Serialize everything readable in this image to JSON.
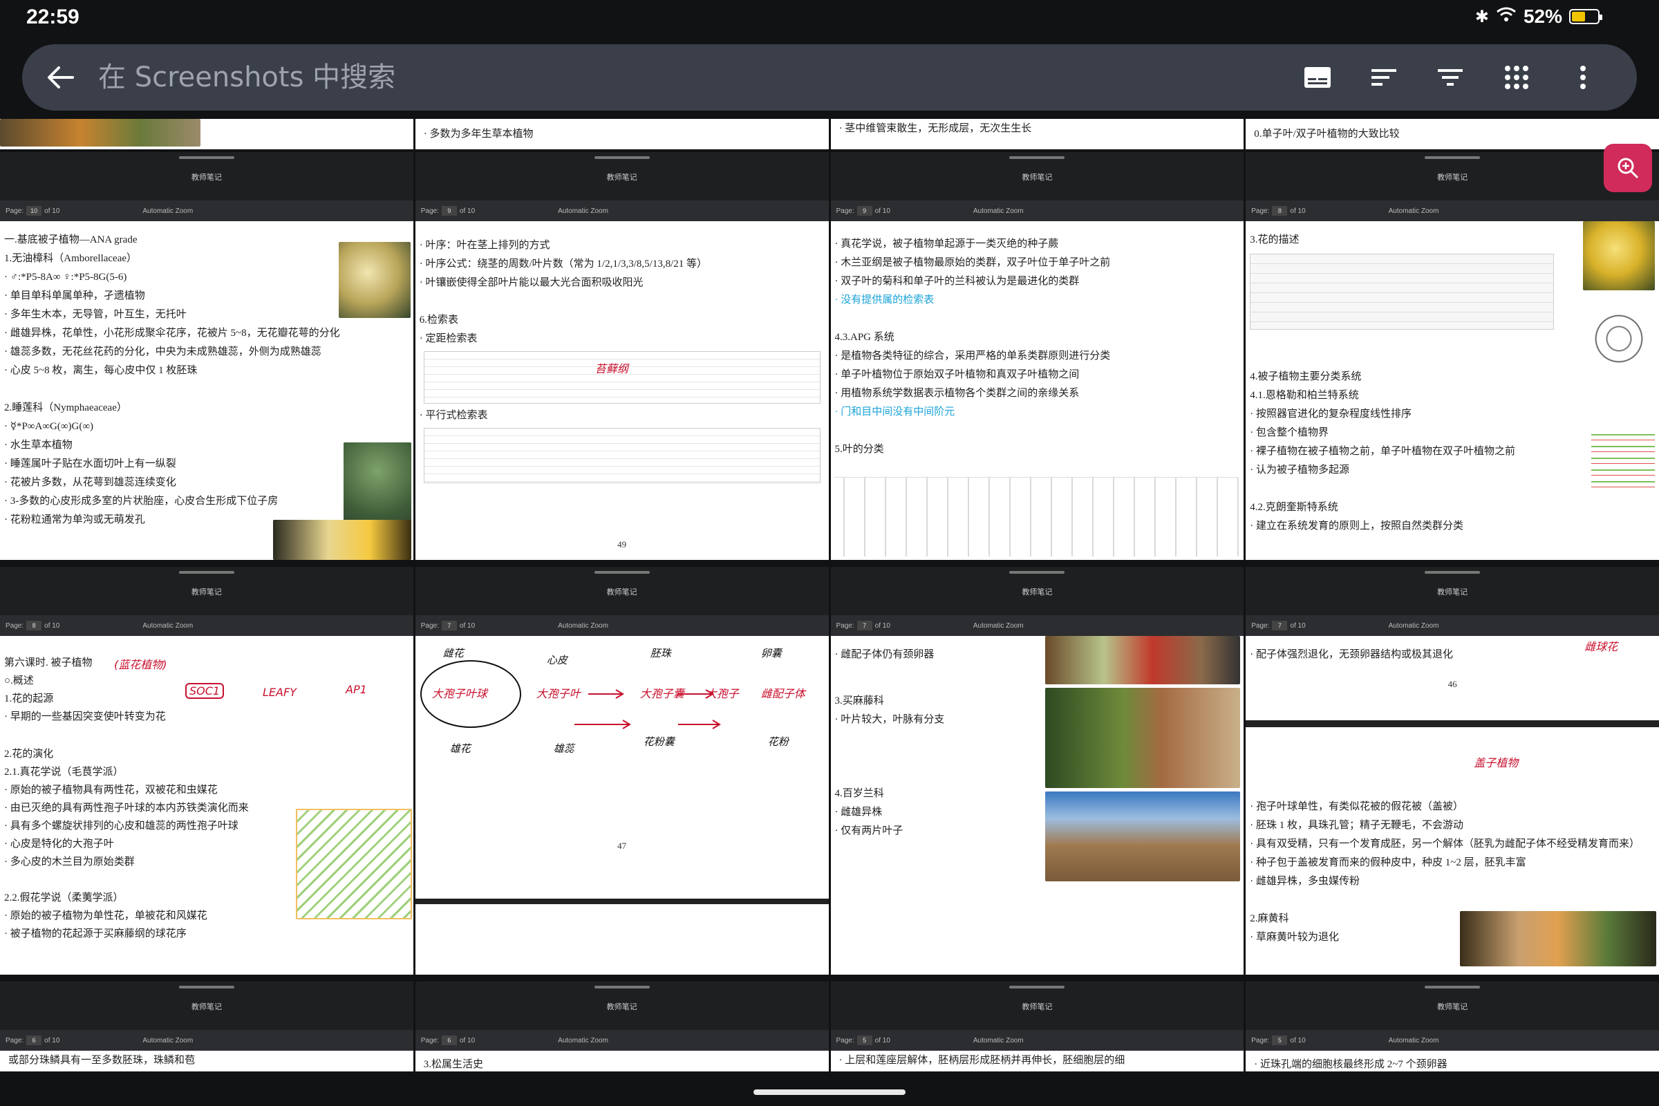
{
  "status": {
    "time": "22:59",
    "battery": "52%",
    "battery_level": 0.52
  },
  "search": {
    "placeholder": "在 Screenshots 中搜索"
  },
  "icons": [
    "back-arrow-icon",
    "subtitles-icon",
    "sort-icon",
    "filter-icon",
    "grid-view-icon",
    "more-vert-icon",
    "zoom-in-icon"
  ],
  "colors": {
    "accent": "#d02b5a",
    "ink": "#c8102e"
  },
  "tile_title": "教师笔记",
  "toolbar": {
    "page": "Page:",
    "of": "of 10",
    "zoom": "Automatic Zoom"
  },
  "top_strip": [
    {
      "text": ""
    },
    {
      "text": "· 多数为多年生草本植物"
    },
    {
      "text": "· 茎中维管束散生，无形成层，无次生生长"
    },
    {
      "text": "0.单子叶/双子叶植物的大致比较"
    }
  ],
  "row1": [
    {
      "page": "10",
      "lines": [
        "一.基底被子植物—ANA grade",
        "1.无油樟科（Amborellaceae）",
        "· ♂:*P5-8A∞   ♀:*P5-8G(5-6)",
        "· 单目单科单属单种，孑遗植物",
        "· 多年生木本，无导管，叶互生，无托叶",
        "· 雌雄异株，花单性，小花形成聚伞花序，花被片 5~8，无花瓣花萼的分化",
        "· 雄蕊多数，无花丝花药的分化，中央为未成熟雄蕊，外侧为成熟雄蕊",
        "· 心皮 5~8 枚，离生，每心皮中仅 1 枚胚珠",
        "",
        "2.睡莲科（Nymphaeaceae）",
        "· ☿*P∞A∞G(∞)G(∞)",
        "· 水生草本植物",
        "· 睡莲属叶子贴在水面切叶上有一纵裂",
        "· 花被片多数，从花萼到雄蕊连续变化",
        "· 3-多数的心皮形成多室的片状胎座，心皮合生形成下位子房",
        "· 花粉粒通常为单沟或无萌发孔"
      ]
    },
    {
      "page": "9",
      "pagenum": "49",
      "lines": [
        "· 叶序：叶在茎上排列的方式",
        "· 叶序公式：绕茎的周数/叶片数（常为 1/2,1/3,3/8,5/13,8/21 等）",
        "· 叶镶嵌使得全部叶片能以最大光合面积吸收阳光",
        "",
        "6.检索表",
        "· 定距检索表",
        "",
        "",
        "",
        "· 平行式检索表"
      ],
      "ink": "苔藓纲"
    },
    {
      "page": "9",
      "lines": [
        "· 真花学说，被子植物单起源于一类灭绝的种子蕨",
        "· 木兰亚纲是被子植物最原始的类群，双子叶位于单子叶之前",
        "· 双子叶的菊科和单子叶的兰科被认为是最进化的类群",
        "· 没有提供属的检索表",
        "",
        "4.3.APG 系统",
        "· 是植物各类特征的综合，采用严格的单系类群原则进行分类",
        "· 单子叶植物位于原始双子叶植物和真双子叶植物之间",
        "· 用植物系统学数据表示植物各个类群之间的亲缘关系",
        "· 门和目中间没有中间阶元",
        "",
        "5.叶的分类"
      ],
      "cyan_lines": [
        3,
        9
      ]
    },
    {
      "page": "8",
      "lines": [
        "3.花的描述",
        "",
        "",
        "",
        "",
        "",
        "",
        "",
        "4.被子植物主要分类系统",
        "4.1.恩格勒和柏兰特系统",
        "· 按照器官进化的复杂程度线性排序",
        "· 包含整个植物界",
        "· 裸子植物在被子植物之前，单子叶植物在双子叶植物之前",
        "· 认为被子植物多起源",
        "",
        "4.2.克朗奎斯特系统",
        "· 建立在系统发育的原则上，按照自然类群分类"
      ]
    }
  ],
  "row2": [
    {
      "page": "8",
      "lines": [
        "",
        "第六课时. 被子植物",
        "○.概述",
        "1.花的起源",
        "· 早期的一些基因突变使叶转变为花",
        "",
        "2.花的演化",
        "2.1.真花学说（毛茛学派）",
        "· 原始的被子植物具有两性花，双被花和虫媒花",
        "· 由已灭绝的具有两性孢子叶球的本内苏铁类演化而来",
        "· 具有多个螺旋状排列的心皮和雄蕊的两性孢子叶球",
        "· 心皮是特化的大孢子叶",
        "· 多心皮的木兰目为原始类群",
        "",
        "2.2.假花学说（柔荑学派）",
        "· 原始的被子植物为单性花，单被花和风媒花",
        "· 被子植物的花起源于买麻藤纲的球花序"
      ],
      "inks": [
        "(蓝花植物)",
        "SOC1",
        "LEAFY",
        "AP1"
      ]
    },
    {
      "page": "7",
      "pagenum": "47",
      "inks": [
        "雌花",
        "心皮",
        "胚珠",
        "卵囊",
        "大孢子叶球",
        "大孢子叶",
        "大孢子囊",
        "大孢子",
        "雌配子体",
        "雄花",
        "雄蕊",
        "花粉囊",
        "花粉"
      ]
    },
    {
      "page": "7",
      "lines": [
        "· 雌配子体仍有颈卵器",
        "",
        "3.买麻藤科",
        "· 叶片较大，叶脉有分支",
        "",
        "",
        "",
        "4.百岁兰科",
        "· 雌雄异株",
        "· 仅有两片叶子"
      ]
    },
    {
      "page": "7",
      "pagenum": "46",
      "lines": [
        "· 配子体强烈退化，无颈卵器结构或极其退化"
      ],
      "lines2": [
        "· 孢子叶球单性，有类似花被的假花被（盖被）",
        "· 胚珠 1 枚，具珠孔管；精子无鞭毛，不会游动",
        "· 具有双受精，只有一个发育成胚，另一个解体（胚乳为雌配子体不经受精发育而来）",
        "· 种子包于盖被发育而来的假种皮中，种皮 1~2 层，胚乳丰富",
        "· 雌雄异株，多虫媒传粉",
        "",
        "2.麻黄科",
        "· 草麻黄叶较为退化"
      ],
      "inks": [
        "盖子植物",
        "雌球花"
      ]
    }
  ],
  "row3": [
    {
      "page": "6",
      "text": "或部分珠鳞具有一至多数胚珠，珠鳞和苞"
    },
    {
      "page": "6",
      "text": "3.松属生活史"
    },
    {
      "page": "5",
      "text": "· 上层和莲座层解体，胚柄层形成胚柄并再伸长，胚细胞层的细"
    },
    {
      "page": "5",
      "text": "· 近珠孔端的细胞核最终形成 2~7 个颈卵器"
    }
  ]
}
